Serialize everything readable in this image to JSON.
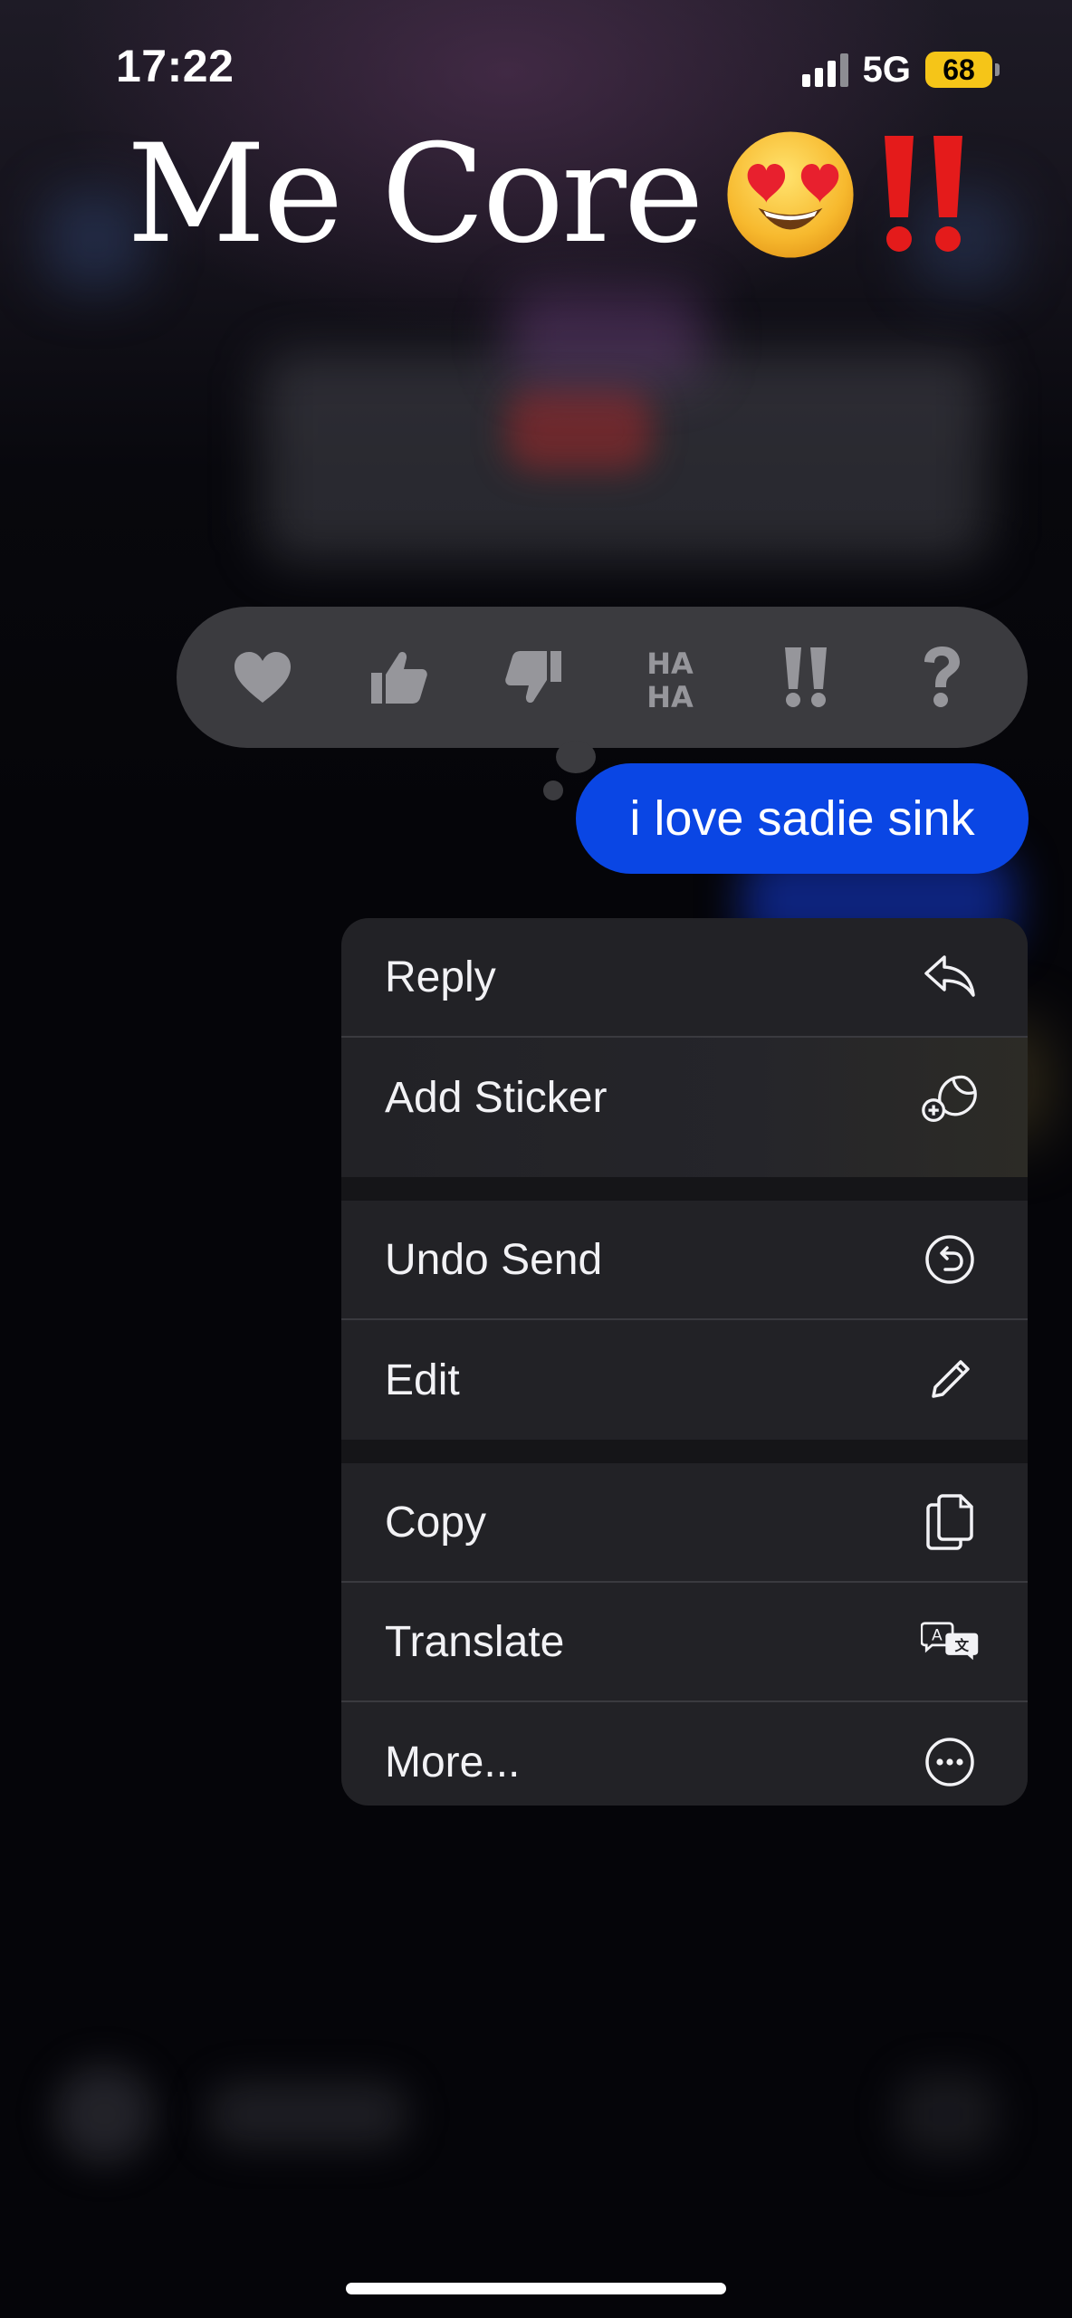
{
  "status_bar": {
    "time": "17:22",
    "network": "5G",
    "battery": "68",
    "battery_color": "#f5c518"
  },
  "overlay": {
    "title": "Me Core",
    "emoji": "heart-eyes-face-emoji",
    "emphasis": "double-exclamation-emoji"
  },
  "tapbacks": [
    {
      "name": "heart",
      "icon": "heart-icon"
    },
    {
      "name": "thumbs-up",
      "icon": "thumbs-up-icon"
    },
    {
      "name": "thumbs-down",
      "icon": "thumbs-down-icon"
    },
    {
      "name": "haha",
      "label": "HA HA",
      "icon": "haha-icon"
    },
    {
      "name": "emphasize",
      "icon": "double-exclamation-icon"
    },
    {
      "name": "question",
      "icon": "question-mark-icon"
    }
  ],
  "message": {
    "text": "i love sadie sink",
    "bubble_color": "#0a46e4"
  },
  "menu": {
    "groups": [
      [
        {
          "label": "Reply",
          "icon": "reply-arrow-icon"
        },
        {
          "label": "Add Sticker",
          "icon": "add-sticker-icon"
        }
      ],
      [
        {
          "label": "Undo Send",
          "icon": "undo-send-icon"
        },
        {
          "label": "Edit",
          "icon": "pencil-icon"
        }
      ],
      [
        {
          "label": "Copy",
          "icon": "copy-icon"
        },
        {
          "label": "Translate",
          "icon": "translate-icon"
        },
        {
          "label": "More...",
          "icon": "more-ellipsis-icon"
        }
      ]
    ]
  }
}
